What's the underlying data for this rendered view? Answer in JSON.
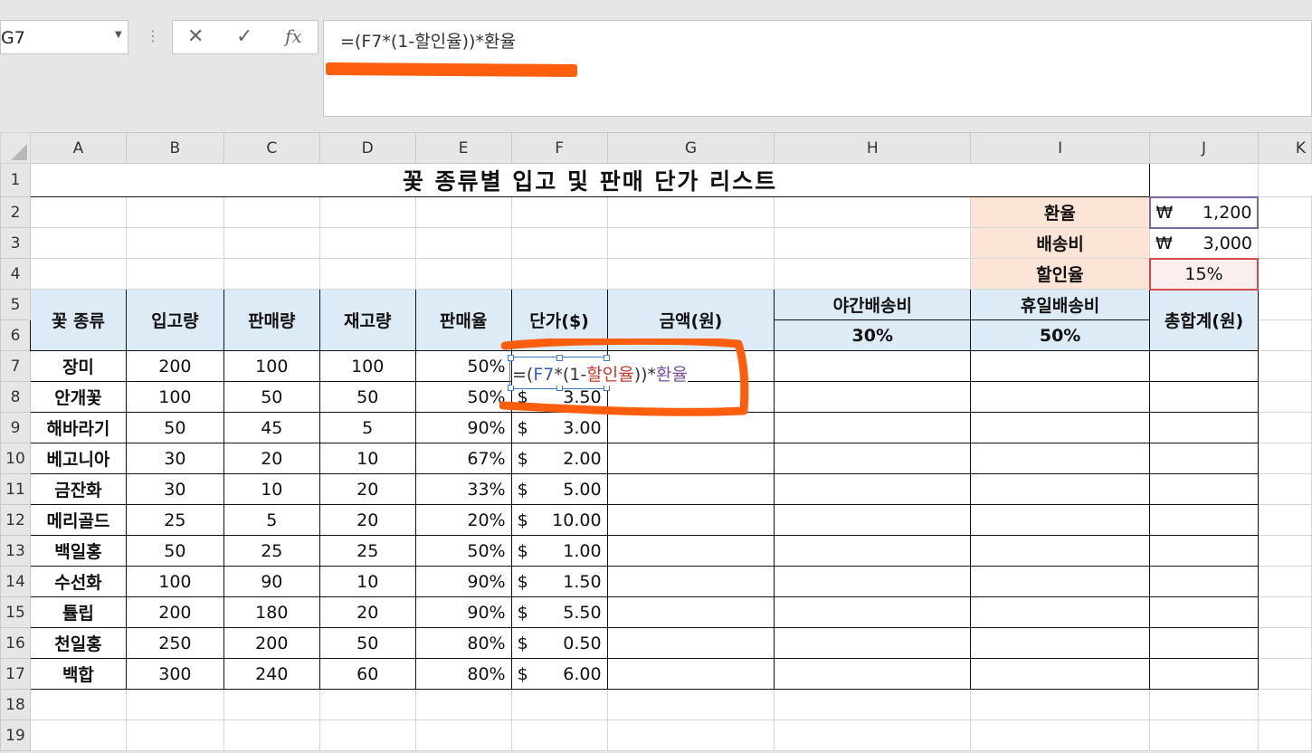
{
  "formula_bar": {
    "name_box": "G7",
    "cancel_icon": "✕",
    "enter_icon": "✓",
    "fx_label": "fx",
    "formula": "=(F7*(1-할인율))*환율"
  },
  "columns": [
    "A",
    "B",
    "C",
    "D",
    "E",
    "F",
    "G",
    "H",
    "I",
    "J",
    "K"
  ],
  "rows": [
    "1",
    "2",
    "3",
    "4",
    "5",
    "6",
    "7",
    "8",
    "9",
    "10",
    "11",
    "12",
    "13",
    "14",
    "15",
    "16",
    "17",
    "18",
    "19"
  ],
  "sheet": {
    "title": "꽃 종류별 입고 및 판매 단가 리스트",
    "params": {
      "exchange_label": "환율",
      "exchange_currency": "₩",
      "exchange_value": "1,200",
      "shipping_label": "배송비",
      "shipping_currency": "₩",
      "shipping_value": "3,000",
      "discount_label": "할인율",
      "discount_value": "15%"
    },
    "headers": {
      "flower": "꽃 종류",
      "in_qty": "입고량",
      "sold": "판매량",
      "stock": "재고량",
      "rate": "판매율",
      "price": "단가($)",
      "amount": "금액(원)",
      "night": "야간배송비",
      "night_rate": "30%",
      "holiday": "휴일배송비",
      "holiday_rate": "50%",
      "total": "총합계(원)"
    },
    "editing": {
      "formula_prefix": "=(",
      "ref": "F7",
      "op1": "*(1-",
      "name1": "할인율",
      "close": "))*",
      "name2": "환율"
    },
    "data_rows": [
      {
        "name": "장미",
        "in": "200",
        "sold": "100",
        "stock": "100",
        "rate": "50%",
        "cur": "",
        "price": ""
      },
      {
        "name": "안개꽃",
        "in": "100",
        "sold": "50",
        "stock": "50",
        "rate": "50%",
        "cur": "$",
        "price": "3.50"
      },
      {
        "name": "해바라기",
        "in": "50",
        "sold": "45",
        "stock": "5",
        "rate": "90%",
        "cur": "$",
        "price": "3.00"
      },
      {
        "name": "베고니아",
        "in": "30",
        "sold": "20",
        "stock": "10",
        "rate": "67%",
        "cur": "$",
        "price": "2.00"
      },
      {
        "name": "금잔화",
        "in": "30",
        "sold": "10",
        "stock": "20",
        "rate": "33%",
        "cur": "$",
        "price": "5.00"
      },
      {
        "name": "메리골드",
        "in": "25",
        "sold": "5",
        "stock": "20",
        "rate": "20%",
        "cur": "$",
        "price": "10.00"
      },
      {
        "name": "백일홍",
        "in": "50",
        "sold": "25",
        "stock": "25",
        "rate": "50%",
        "cur": "$",
        "price": "1.00"
      },
      {
        "name": "수선화",
        "in": "100",
        "sold": "90",
        "stock": "10",
        "rate": "90%",
        "cur": "$",
        "price": "1.50"
      },
      {
        "name": "튤립",
        "in": "200",
        "sold": "180",
        "stock": "20",
        "rate": "90%",
        "cur": "$",
        "price": "5.50"
      },
      {
        "name": "천일홍",
        "in": "250",
        "sold": "200",
        "stock": "50",
        "rate": "80%",
        "cur": "$",
        "price": "0.50"
      },
      {
        "name": "백합",
        "in": "300",
        "sold": "240",
        "stock": "60",
        "rate": "80%",
        "cur": "$",
        "price": "6.00"
      }
    ]
  },
  "colors": {
    "header_fill": "#ddebf7",
    "param_fill": "#fce4d6",
    "annotation": "#fd5e0d",
    "ref_blue": "#2f5fb0",
    "ref_red": "#c0392b",
    "ref_purple": "#7a4fa0"
  }
}
